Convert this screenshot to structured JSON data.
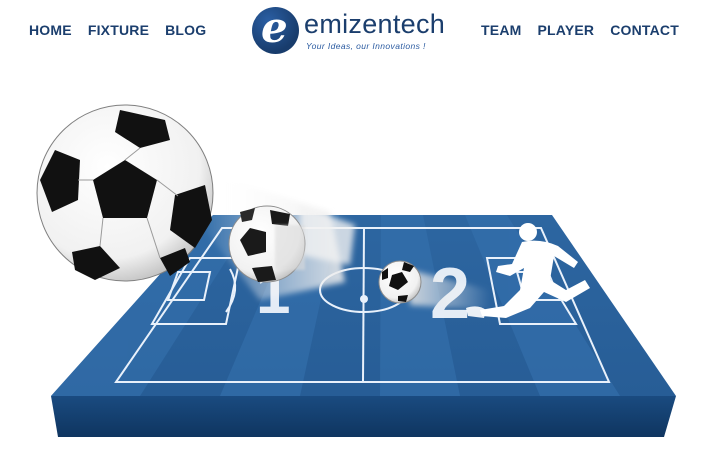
{
  "nav": {
    "left": [
      {
        "label": "HOME"
      },
      {
        "label": "FIXTURE"
      },
      {
        "label": "BLOG"
      }
    ],
    "right": [
      {
        "label": "TEAM"
      },
      {
        "label": "PLAYER"
      },
      {
        "label": "CONTACT"
      }
    ]
  },
  "logo": {
    "mark": "e",
    "name": "emizentech",
    "tagline": "Your Ideas, our Innovations !"
  },
  "hero": {
    "score_home": "1",
    "score_away": "2",
    "colors": {
      "pitch": "#2f68a3",
      "pitch_dark": "#1d4d82",
      "pitch_side": "#123a66",
      "nav_text": "#1b3e6d"
    }
  }
}
